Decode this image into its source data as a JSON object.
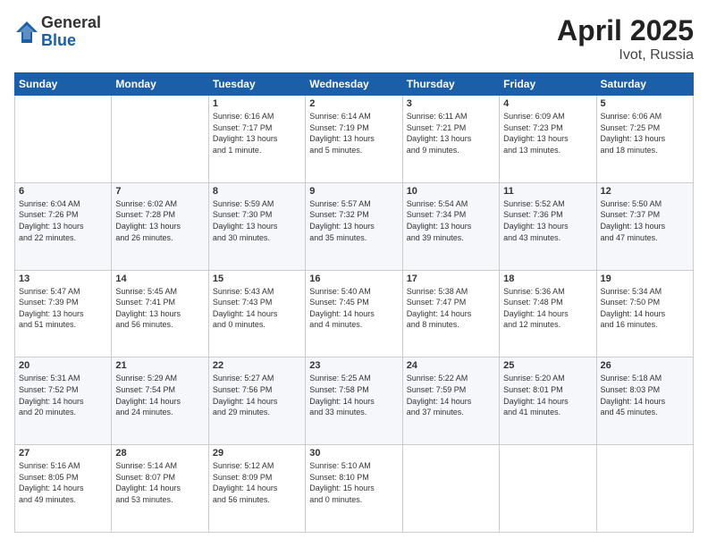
{
  "logo": {
    "general": "General",
    "blue": "Blue"
  },
  "title": {
    "month": "April 2025",
    "location": "Ivot, Russia"
  },
  "headers": [
    "Sunday",
    "Monday",
    "Tuesday",
    "Wednesday",
    "Thursday",
    "Friday",
    "Saturday"
  ],
  "weeks": [
    [
      {
        "day": "",
        "detail": ""
      },
      {
        "day": "",
        "detail": ""
      },
      {
        "day": "1",
        "detail": "Sunrise: 6:16 AM\nSunset: 7:17 PM\nDaylight: 13 hours\nand 1 minute."
      },
      {
        "day": "2",
        "detail": "Sunrise: 6:14 AM\nSunset: 7:19 PM\nDaylight: 13 hours\nand 5 minutes."
      },
      {
        "day": "3",
        "detail": "Sunrise: 6:11 AM\nSunset: 7:21 PM\nDaylight: 13 hours\nand 9 minutes."
      },
      {
        "day": "4",
        "detail": "Sunrise: 6:09 AM\nSunset: 7:23 PM\nDaylight: 13 hours\nand 13 minutes."
      },
      {
        "day": "5",
        "detail": "Sunrise: 6:06 AM\nSunset: 7:25 PM\nDaylight: 13 hours\nand 18 minutes."
      }
    ],
    [
      {
        "day": "6",
        "detail": "Sunrise: 6:04 AM\nSunset: 7:26 PM\nDaylight: 13 hours\nand 22 minutes."
      },
      {
        "day": "7",
        "detail": "Sunrise: 6:02 AM\nSunset: 7:28 PM\nDaylight: 13 hours\nand 26 minutes."
      },
      {
        "day": "8",
        "detail": "Sunrise: 5:59 AM\nSunset: 7:30 PM\nDaylight: 13 hours\nand 30 minutes."
      },
      {
        "day": "9",
        "detail": "Sunrise: 5:57 AM\nSunset: 7:32 PM\nDaylight: 13 hours\nand 35 minutes."
      },
      {
        "day": "10",
        "detail": "Sunrise: 5:54 AM\nSunset: 7:34 PM\nDaylight: 13 hours\nand 39 minutes."
      },
      {
        "day": "11",
        "detail": "Sunrise: 5:52 AM\nSunset: 7:36 PM\nDaylight: 13 hours\nand 43 minutes."
      },
      {
        "day": "12",
        "detail": "Sunrise: 5:50 AM\nSunset: 7:37 PM\nDaylight: 13 hours\nand 47 minutes."
      }
    ],
    [
      {
        "day": "13",
        "detail": "Sunrise: 5:47 AM\nSunset: 7:39 PM\nDaylight: 13 hours\nand 51 minutes."
      },
      {
        "day": "14",
        "detail": "Sunrise: 5:45 AM\nSunset: 7:41 PM\nDaylight: 13 hours\nand 56 minutes."
      },
      {
        "day": "15",
        "detail": "Sunrise: 5:43 AM\nSunset: 7:43 PM\nDaylight: 14 hours\nand 0 minutes."
      },
      {
        "day": "16",
        "detail": "Sunrise: 5:40 AM\nSunset: 7:45 PM\nDaylight: 14 hours\nand 4 minutes."
      },
      {
        "day": "17",
        "detail": "Sunrise: 5:38 AM\nSunset: 7:47 PM\nDaylight: 14 hours\nand 8 minutes."
      },
      {
        "day": "18",
        "detail": "Sunrise: 5:36 AM\nSunset: 7:48 PM\nDaylight: 14 hours\nand 12 minutes."
      },
      {
        "day": "19",
        "detail": "Sunrise: 5:34 AM\nSunset: 7:50 PM\nDaylight: 14 hours\nand 16 minutes."
      }
    ],
    [
      {
        "day": "20",
        "detail": "Sunrise: 5:31 AM\nSunset: 7:52 PM\nDaylight: 14 hours\nand 20 minutes."
      },
      {
        "day": "21",
        "detail": "Sunrise: 5:29 AM\nSunset: 7:54 PM\nDaylight: 14 hours\nand 24 minutes."
      },
      {
        "day": "22",
        "detail": "Sunrise: 5:27 AM\nSunset: 7:56 PM\nDaylight: 14 hours\nand 29 minutes."
      },
      {
        "day": "23",
        "detail": "Sunrise: 5:25 AM\nSunset: 7:58 PM\nDaylight: 14 hours\nand 33 minutes."
      },
      {
        "day": "24",
        "detail": "Sunrise: 5:22 AM\nSunset: 7:59 PM\nDaylight: 14 hours\nand 37 minutes."
      },
      {
        "day": "25",
        "detail": "Sunrise: 5:20 AM\nSunset: 8:01 PM\nDaylight: 14 hours\nand 41 minutes."
      },
      {
        "day": "26",
        "detail": "Sunrise: 5:18 AM\nSunset: 8:03 PM\nDaylight: 14 hours\nand 45 minutes."
      }
    ],
    [
      {
        "day": "27",
        "detail": "Sunrise: 5:16 AM\nSunset: 8:05 PM\nDaylight: 14 hours\nand 49 minutes."
      },
      {
        "day": "28",
        "detail": "Sunrise: 5:14 AM\nSunset: 8:07 PM\nDaylight: 14 hours\nand 53 minutes."
      },
      {
        "day": "29",
        "detail": "Sunrise: 5:12 AM\nSunset: 8:09 PM\nDaylight: 14 hours\nand 56 minutes."
      },
      {
        "day": "30",
        "detail": "Sunrise: 5:10 AM\nSunset: 8:10 PM\nDaylight: 15 hours\nand 0 minutes."
      },
      {
        "day": "",
        "detail": ""
      },
      {
        "day": "",
        "detail": ""
      },
      {
        "day": "",
        "detail": ""
      }
    ]
  ]
}
